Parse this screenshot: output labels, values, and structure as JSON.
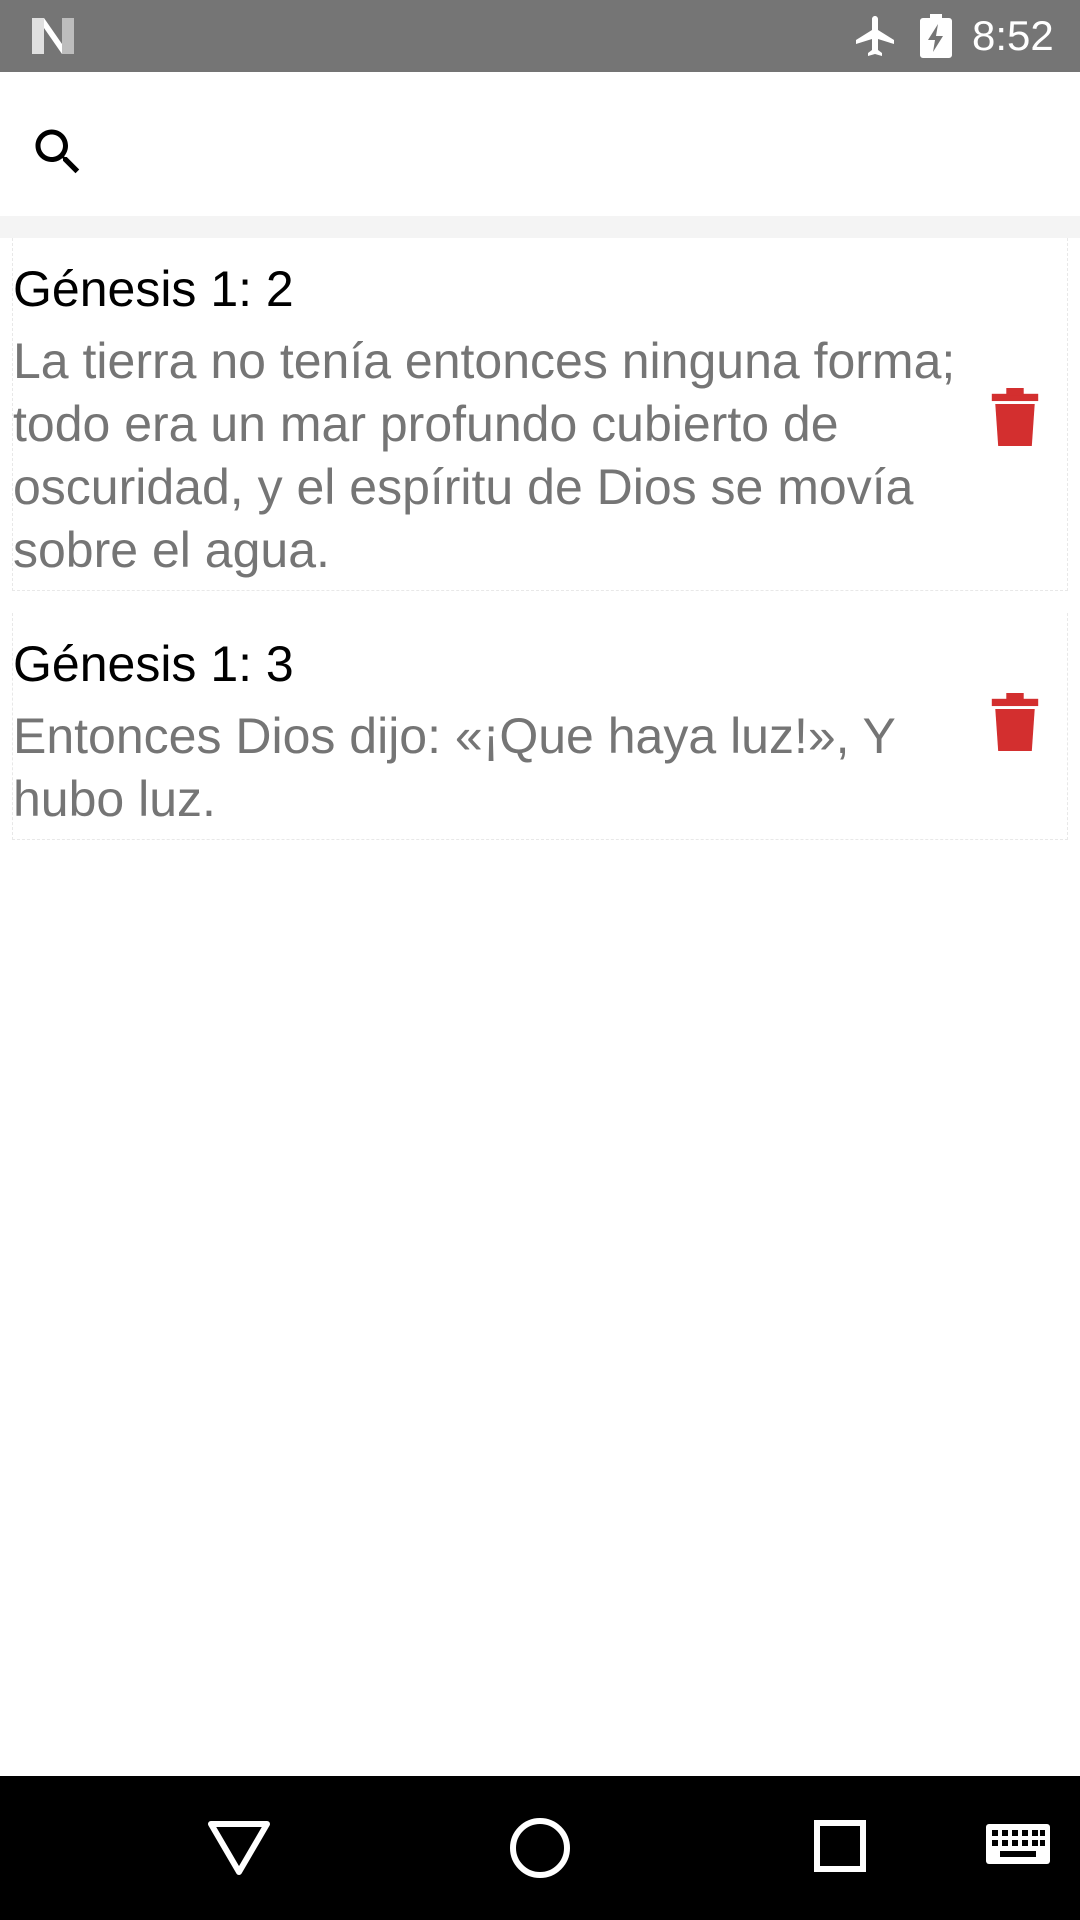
{
  "status_bar": {
    "time": "8:52",
    "icons": [
      "notification-n-icon",
      "airplane-mode-icon",
      "battery-charging-icon"
    ]
  },
  "search": {
    "placeholder": "",
    "value": "",
    "icon": "search-icon"
  },
  "verses": [
    {
      "reference": "Génesis 1: 2",
      "text": "La tierra no tenía entonces ninguna forma; todo era un mar profundo cubierto de oscuridad, y el espíritu de Dios se movía sobre el agua."
    },
    {
      "reference": "Génesis 1: 3",
      "text": "Entonces Dios dijo: «¡Que haya luz!», Y hubo luz."
    }
  ],
  "colors": {
    "status_bar": "#757575",
    "delete_icon": "#d32f2f",
    "verse_text": "#757575",
    "nav_bar": "#000000"
  },
  "nav_bar": {
    "icons": [
      "back-icon",
      "home-icon",
      "recents-icon",
      "keyboard-icon"
    ]
  }
}
